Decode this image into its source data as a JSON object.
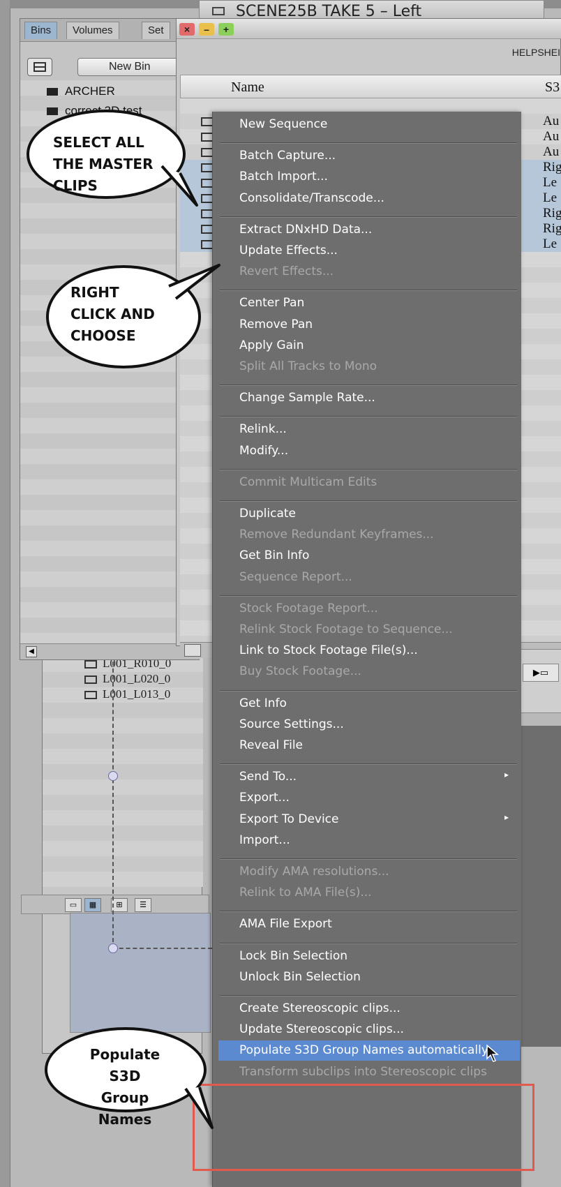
{
  "top_title": "SCENE25B TAKE 5 – Left",
  "project_window": {
    "tabs": [
      "Bins",
      "Volumes",
      "Set"
    ],
    "new_bin_label": "New Bin",
    "bins": [
      "ARCHER",
      "correct 3D test"
    ]
  },
  "bin_window": {
    "title": "HELPSHEI",
    "columns": {
      "name": "Name",
      "s3d": "S3"
    },
    "rows": [
      {
        "value": "Au",
        "selected": false
      },
      {
        "value": "Au",
        "selected": false
      },
      {
        "value": "Au",
        "selected": false
      },
      {
        "value": "Rig",
        "selected": true
      },
      {
        "value": "Le",
        "selected": true
      },
      {
        "value": "Le",
        "selected": true
      },
      {
        "value": "Rig",
        "selected": true
      },
      {
        "value": "Rig",
        "selected": true
      },
      {
        "value": "Le",
        "selected": true
      }
    ]
  },
  "background_clips": [
    "L001_R010_0",
    "L001_L020_0",
    "L001_L013_0"
  ],
  "context_menu": {
    "sections": [
      [
        {
          "label": "New Sequence",
          "enabled": true
        }
      ],
      [
        {
          "label": "Batch Capture...",
          "enabled": true
        },
        {
          "label": "Batch Import...",
          "enabled": true
        },
        {
          "label": "Consolidate/Transcode...",
          "enabled": true
        }
      ],
      [
        {
          "label": "Extract DNxHD Data...",
          "enabled": true
        },
        {
          "label": "Update Effects...",
          "enabled": true
        },
        {
          "label": "Revert Effects...",
          "enabled": false
        }
      ],
      [
        {
          "label": "Center Pan",
          "enabled": true
        },
        {
          "label": "Remove Pan",
          "enabled": true
        },
        {
          "label": "Apply Gain",
          "enabled": true
        },
        {
          "label": "Split All Tracks to Mono",
          "enabled": false
        }
      ],
      [
        {
          "label": "Change Sample Rate...",
          "enabled": true
        }
      ],
      [
        {
          "label": "Relink...",
          "enabled": true
        },
        {
          "label": "Modify...",
          "enabled": true
        }
      ],
      [
        {
          "label": "Commit Multicam Edits",
          "enabled": false
        }
      ],
      [
        {
          "label": "Duplicate",
          "enabled": true
        },
        {
          "label": "Remove Redundant Keyframes...",
          "enabled": false
        },
        {
          "label": "Get Bin Info",
          "enabled": true
        },
        {
          "label": "Sequence Report...",
          "enabled": false
        }
      ],
      [
        {
          "label": "Stock Footage Report...",
          "enabled": false
        },
        {
          "label": "Relink Stock Footage to Sequence...",
          "enabled": false
        },
        {
          "label": "Link to Stock Footage File(s)...",
          "enabled": true
        },
        {
          "label": "Buy Stock Footage...",
          "enabled": false
        }
      ],
      [
        {
          "label": "Get Info",
          "enabled": true
        },
        {
          "label": "Source Settings...",
          "enabled": true
        },
        {
          "label": "Reveal File",
          "enabled": true
        }
      ],
      [
        {
          "label": "Send To...",
          "enabled": true,
          "submenu": true
        },
        {
          "label": "Export...",
          "enabled": true
        },
        {
          "label": "Export To Device",
          "enabled": true,
          "submenu": true
        },
        {
          "label": "Import...",
          "enabled": true
        }
      ],
      [
        {
          "label": "Modify AMA resolutions...",
          "enabled": false
        },
        {
          "label": "Relink to AMA File(s)...",
          "enabled": false
        }
      ],
      [
        {
          "label": "AMA File Export",
          "enabled": true
        }
      ],
      [
        {
          "label": "Lock Bin Selection",
          "enabled": true
        },
        {
          "label": "Unlock Bin Selection",
          "enabled": true
        }
      ],
      [
        {
          "label": "Create Stereoscopic clips...",
          "enabled": true
        },
        {
          "label": "Update Stereoscopic clips...",
          "enabled": true
        },
        {
          "label": "Populate S3D Group Names automatically",
          "enabled": true,
          "highlighted": true
        },
        {
          "label": "Transform subclips into Stereoscopic clips",
          "enabled": false
        }
      ]
    ]
  },
  "callouts": {
    "select": [
      "SELECT ALL",
      "THE MASTER",
      "CLIPS"
    ],
    "right_click": [
      "RIGHT",
      "CLICK AND",
      "CHOOSE"
    ],
    "populate": [
      "Populate S3D",
      "Group Names"
    ]
  },
  "colors": {
    "menu_bg": "#6e6e6e",
    "highlight": "#5b8ad0",
    "red_box": "#e05a4e",
    "selected_row": "#b6c7da"
  }
}
